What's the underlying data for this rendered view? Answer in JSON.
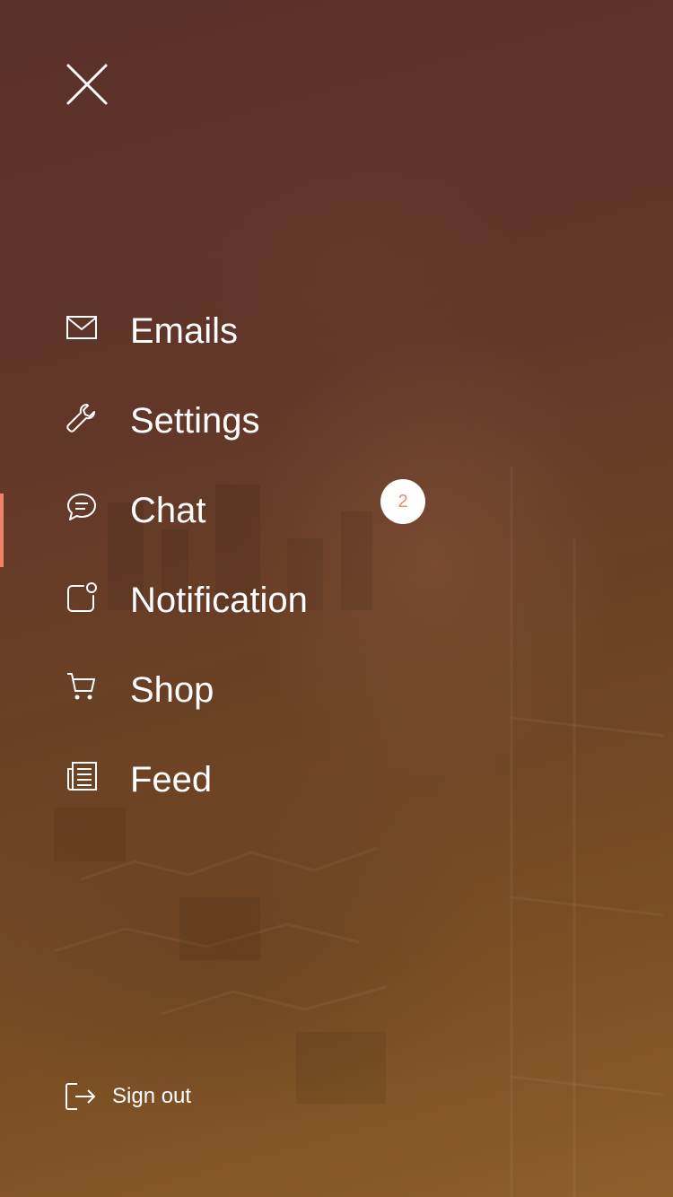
{
  "menu": {
    "items": [
      {
        "label": "Emails",
        "icon": "mail-icon"
      },
      {
        "label": "Settings",
        "icon": "wrench-icon"
      },
      {
        "label": "Chat",
        "icon": "chat-bubble-icon",
        "badge": "2",
        "active": true
      },
      {
        "label": "Notification",
        "icon": "notification-icon"
      },
      {
        "label": "Shop",
        "icon": "cart-icon"
      },
      {
        "label": "Feed",
        "icon": "newspaper-icon"
      }
    ]
  },
  "footer": {
    "signout_label": "Sign out",
    "signout_icon": "sign-out-icon"
  },
  "colors": {
    "accent": "#f0826a",
    "badge_text": "#ef8a72",
    "text": "#ffffff"
  }
}
